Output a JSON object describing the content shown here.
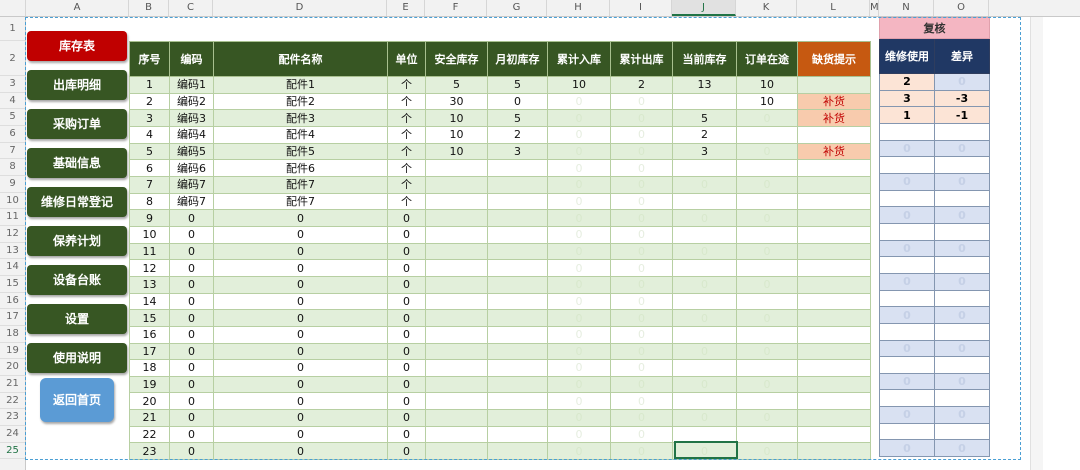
{
  "columns": [
    "A",
    "B",
    "C",
    "D",
    "E",
    "F",
    "G",
    "H",
    "I",
    "J",
    "K",
    "L",
    "M",
    "N",
    "O"
  ],
  "selected_column": "J",
  "row_numbers": [
    "1",
    "2",
    "3",
    "4",
    "5",
    "6",
    "7",
    "8",
    "9",
    "10",
    "11",
    "12",
    "13",
    "14",
    "15",
    "16",
    "17",
    "18",
    "19",
    "20",
    "21",
    "22",
    "23",
    "24",
    "25"
  ],
  "nav": {
    "buttons": [
      "库存表",
      "出库明细",
      "采购订单",
      "基础信息",
      "维修日常登记",
      "保养计划",
      "设备台账",
      "设置",
      "使用说明"
    ],
    "active": "库存表",
    "home": "返回首页"
  },
  "table": {
    "headers": [
      "序号",
      "编码",
      "配件名称",
      "单位",
      "安全库存",
      "月初库存",
      "累计入库",
      "累计出库",
      "当前库存",
      "订单在途",
      "缺货提示"
    ],
    "rows": [
      [
        "1",
        "编码1",
        "配件1",
        "个",
        "5",
        "5",
        "10",
        "2",
        "13",
        "10",
        ""
      ],
      [
        "2",
        "编码2",
        "配件2",
        "个",
        "30",
        "0",
        "0",
        "0",
        "",
        "10",
        "补货"
      ],
      [
        "3",
        "编码3",
        "配件3",
        "个",
        "10",
        "5",
        "0",
        "0",
        "5",
        "0",
        "补货"
      ],
      [
        "4",
        "编码4",
        "配件4",
        "个",
        "10",
        "2",
        "0",
        "0",
        "2",
        "",
        ""
      ],
      [
        "5",
        "编码5",
        "配件5",
        "个",
        "10",
        "3",
        "0",
        "0",
        "3",
        "0",
        "补货"
      ],
      [
        "6",
        "编码6",
        "配件6",
        "个",
        "",
        "",
        "0",
        "0",
        "",
        "",
        ""
      ],
      [
        "7",
        "编码7",
        "配件7",
        "个",
        "",
        "",
        "0",
        "0",
        "0",
        "0",
        ""
      ],
      [
        "8",
        "编码7",
        "配件7",
        "个",
        "",
        "",
        "0",
        "0",
        "",
        "",
        ""
      ],
      [
        "9",
        "0",
        "0",
        "0",
        "",
        "",
        "0",
        "0",
        "0",
        "0",
        ""
      ],
      [
        "10",
        "0",
        "0",
        "0",
        "",
        "",
        "0",
        "0",
        "",
        "",
        ""
      ],
      [
        "11",
        "0",
        "0",
        "0",
        "",
        "",
        "0",
        "0",
        "0",
        "0",
        ""
      ],
      [
        "12",
        "0",
        "0",
        "0",
        "",
        "",
        "0",
        "0",
        "",
        "",
        ""
      ],
      [
        "13",
        "0",
        "0",
        "0",
        "",
        "",
        "0",
        "0",
        "0",
        "0",
        ""
      ],
      [
        "14",
        "0",
        "0",
        "0",
        "",
        "",
        "0",
        "0",
        "",
        "",
        ""
      ],
      [
        "15",
        "0",
        "0",
        "0",
        "",
        "",
        "0",
        "0",
        "0",
        "0",
        ""
      ],
      [
        "16",
        "0",
        "0",
        "0",
        "",
        "",
        "0",
        "0",
        "",
        "",
        ""
      ],
      [
        "17",
        "0",
        "0",
        "0",
        "",
        "",
        "0",
        "0",
        "0",
        "0",
        ""
      ],
      [
        "18",
        "0",
        "0",
        "0",
        "",
        "",
        "0",
        "0",
        "",
        "",
        ""
      ],
      [
        "19",
        "0",
        "0",
        "0",
        "",
        "",
        "0",
        "0",
        "0",
        "0",
        ""
      ],
      [
        "20",
        "0",
        "0",
        "0",
        "",
        "",
        "0",
        "0",
        "",
        "",
        ""
      ],
      [
        "21",
        "0",
        "0",
        "0",
        "",
        "",
        "0",
        "0",
        "0",
        "0",
        ""
      ],
      [
        "22",
        "0",
        "0",
        "0",
        "",
        "",
        "0",
        "0",
        "",
        "",
        ""
      ],
      [
        "23",
        "0",
        "0",
        "0",
        "",
        "",
        "0",
        "0",
        "0",
        "0",
        ""
      ]
    ]
  },
  "review": {
    "title": "复核",
    "headers": [
      "维修使用",
      "差异"
    ],
    "rows": [
      [
        "2",
        "0"
      ],
      [
        "3",
        "-3"
      ],
      [
        "1",
        "-1"
      ],
      [
        "",
        ""
      ],
      [
        "0",
        "0"
      ],
      [
        "",
        ""
      ],
      [
        "0",
        "0"
      ],
      [
        "",
        ""
      ],
      [
        "0",
        "0"
      ],
      [
        "",
        ""
      ],
      [
        "0",
        "0"
      ],
      [
        "",
        ""
      ],
      [
        "0",
        "0"
      ],
      [
        "",
        ""
      ],
      [
        "0",
        "0"
      ],
      [
        "",
        ""
      ],
      [
        "0",
        "0"
      ],
      [
        "",
        ""
      ],
      [
        "0",
        "0"
      ],
      [
        "",
        ""
      ],
      [
        "0",
        "0"
      ],
      [
        "",
        ""
      ],
      [
        "0",
        "0"
      ]
    ]
  },
  "colors": {
    "header_green": "#375623",
    "active_red": "#c00000",
    "warn_orange": "#c65911",
    "home_blue": "#5b9bd5",
    "review_navy": "#203864",
    "review_pink": "#f4b6c2"
  }
}
